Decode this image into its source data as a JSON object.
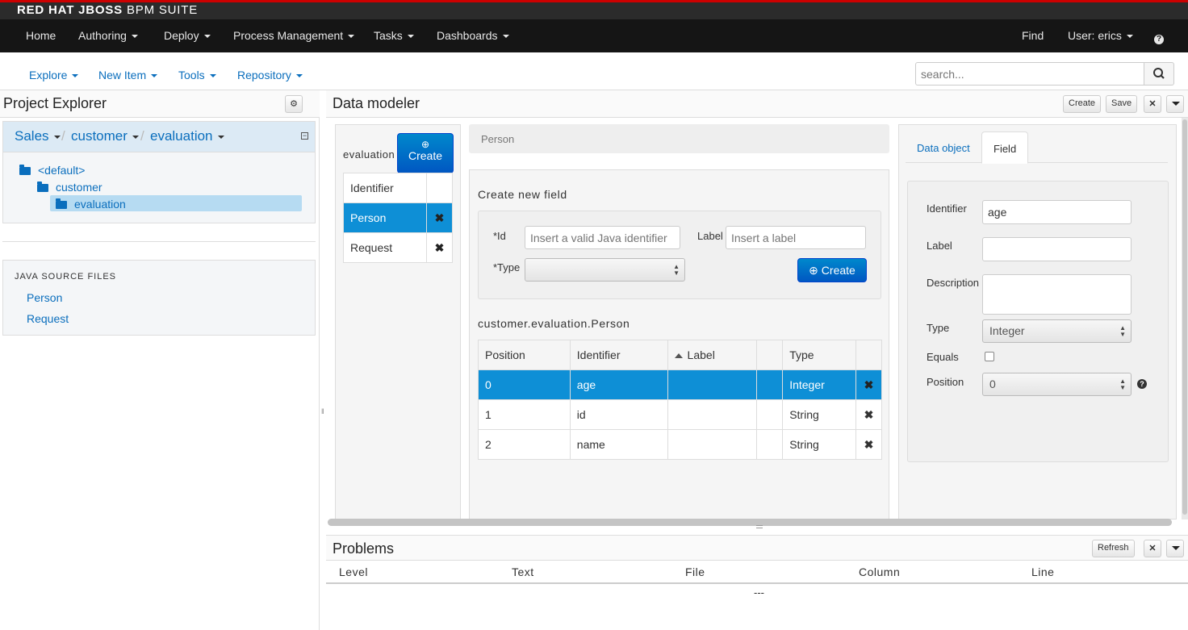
{
  "brand": {
    "bold": "RED HAT JBOSS",
    "rest": "BPM SUITE"
  },
  "topnav": {
    "items": [
      "Home",
      "Authoring",
      "Deploy",
      "Process Management",
      "Tasks",
      "Dashboards"
    ],
    "find": "Find",
    "user": "User: erics",
    "help_glyph": "?"
  },
  "subnav": {
    "items": [
      "Explore",
      "New Item",
      "Tools",
      "Repository"
    ],
    "search_placeholder": "search..."
  },
  "project_explorer": {
    "title": "Project Explorer",
    "breadcrumb": [
      "Sales",
      "customer",
      "evaluation"
    ],
    "tree": [
      "<default>",
      "customer",
      "evaluation"
    ],
    "selected_tree_item": "evaluation",
    "java_source_title": "JAVA SOURCE FILES",
    "java_sources": [
      "Person",
      "Request"
    ]
  },
  "data_modeler": {
    "title": "Data modeler",
    "buttons": {
      "create": "Create",
      "save": "Save"
    },
    "package_label": "evaluation",
    "create_object_label": "Create",
    "objects_header": "Identifier",
    "objects": [
      "Person",
      "Request"
    ],
    "selected_object": "Person",
    "object_header": "Person",
    "create_field": {
      "title": "Create new field",
      "id_label": "*Id",
      "id_placeholder": "Insert a valid Java identifier",
      "label_label": "Label",
      "label_placeholder": "Insert a label",
      "type_label": "*Type",
      "create_button": "Create"
    },
    "fqn": "customer.evaluation.Person",
    "fields_table": {
      "headers": [
        "Position",
        "Identifier",
        "Label",
        "",
        "Type"
      ],
      "rows": [
        {
          "position": "0",
          "identifier": "age",
          "label": "",
          "type": "Integer"
        },
        {
          "position": "1",
          "identifier": "id",
          "label": "",
          "type": "String"
        },
        {
          "position": "2",
          "identifier": "name",
          "label": "",
          "type": "String"
        }
      ]
    },
    "properties": {
      "tabs": [
        "Data object",
        "Field"
      ],
      "active_tab": "Field",
      "identifier_label": "Identifier",
      "identifier_value": "age",
      "label_label": "Label",
      "label_value": "",
      "description_label": "Description",
      "description_value": "",
      "type_label": "Type",
      "type_value": "Integer",
      "equals_label": "Equals",
      "position_label": "Position",
      "position_value": "0"
    }
  },
  "problems": {
    "title": "Problems",
    "refresh": "Refresh",
    "columns": [
      "Level",
      "Text",
      "File",
      "Column",
      "Line"
    ],
    "empty": "---"
  },
  "colors": {
    "accent": "#0a6ebd",
    "selection": "#0e8fd6",
    "brand_red": "#cc0000"
  }
}
